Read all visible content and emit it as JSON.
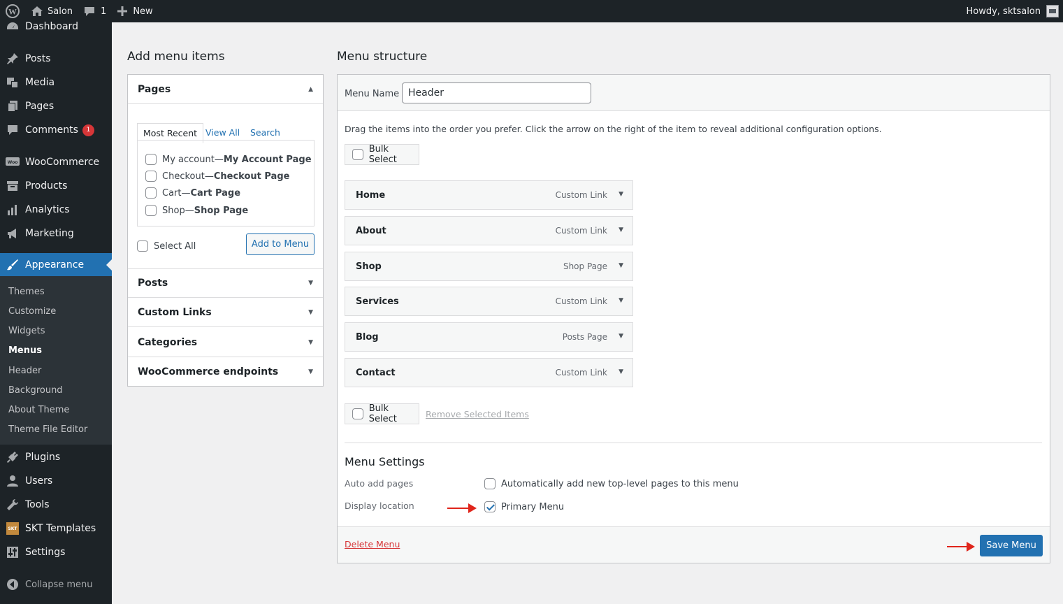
{
  "adminbar": {
    "site_name": "Salon",
    "comments_count": "1",
    "new_label": "New",
    "howdy": "Howdy, sktsalon"
  },
  "sidebar": {
    "items": [
      {
        "label": "Dashboard",
        "icon": "dashboard-icon"
      },
      {
        "label": "Posts",
        "icon": "pin-icon"
      },
      {
        "label": "Media",
        "icon": "media-icon"
      },
      {
        "label": "Pages",
        "icon": "pages-icon"
      },
      {
        "label": "Comments",
        "icon": "comment-icon",
        "badge": "1"
      },
      {
        "label": "WooCommerce",
        "icon": "woo-icon"
      },
      {
        "label": "Products",
        "icon": "archive-icon"
      },
      {
        "label": "Analytics",
        "icon": "bar-chart-icon"
      },
      {
        "label": "Marketing",
        "icon": "megaphone-icon"
      },
      {
        "label": "Appearance",
        "icon": "brush-icon"
      },
      {
        "label": "Plugins",
        "icon": "plug-icon"
      },
      {
        "label": "Users",
        "icon": "user-icon"
      },
      {
        "label": "Tools",
        "icon": "wrench-icon"
      },
      {
        "label": "SKT Templates",
        "icon": "skt-icon"
      },
      {
        "label": "Settings",
        "icon": "sliders-icon"
      },
      {
        "label": "Collapse menu",
        "icon": "collapse-icon"
      }
    ],
    "submenu": [
      "Themes",
      "Customize",
      "Widgets",
      "Menus",
      "Header",
      "Background",
      "About Theme",
      "Theme File Editor"
    ]
  },
  "left": {
    "heading": "Add menu items",
    "pages_title": "Pages",
    "tabs": [
      "Most Recent",
      "View All",
      "Search"
    ],
    "pages": [
      {
        "name": "My account",
        "sep": " — ",
        "type": "My Account Page"
      },
      {
        "name": "Checkout",
        "sep": " — ",
        "type": "Checkout Page"
      },
      {
        "name": "Cart",
        "sep": " — ",
        "type": "Cart Page"
      },
      {
        "name": "Shop",
        "sep": " — ",
        "type": "Shop Page"
      }
    ],
    "select_all": "Select All",
    "add_to_menu": "Add to Menu",
    "sections": [
      "Posts",
      "Custom Links",
      "Categories",
      "WooCommerce endpoints"
    ]
  },
  "right": {
    "heading": "Menu structure",
    "menu_name_label": "Menu Name",
    "menu_name_value": "Header",
    "instructions": "Drag the items into the order you prefer. Click the arrow on the right of the item to reveal additional configuration options.",
    "bulk_select": "Bulk Select",
    "remove_selected": "Remove Selected Items",
    "items": [
      {
        "title": "Home",
        "type": "Custom Link"
      },
      {
        "title": "About",
        "type": "Custom Link"
      },
      {
        "title": "Shop",
        "type": "Shop Page"
      },
      {
        "title": "Services",
        "type": "Custom Link"
      },
      {
        "title": "Blog",
        "type": "Posts Page"
      },
      {
        "title": "Contact",
        "type": "Custom Link"
      }
    ],
    "settings_heading": "Menu Settings",
    "auto_add_label": "Auto add pages",
    "auto_add_text": "Automatically add new top-level pages to this menu",
    "auto_add_checked": false,
    "display_location_label": "Display location",
    "primary_menu_text": "Primary Menu",
    "primary_menu_checked": true,
    "delete_menu": "Delete Menu",
    "save_menu": "Save Menu"
  },
  "colors": {
    "accent": "#2271b1",
    "danger": "#d63638",
    "annotation": "#e0251b",
    "sidebar_bg": "#1d2327"
  }
}
